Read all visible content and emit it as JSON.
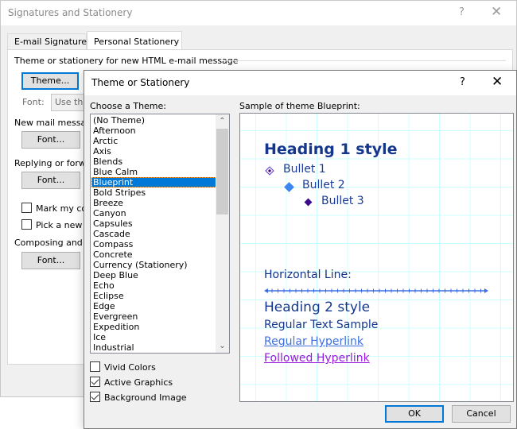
{
  "back_window": {
    "title": "Signatures and Stationery",
    "help_glyph": "?",
    "close_glyph": "✕",
    "tabs": [
      {
        "label": "E-mail Signature",
        "selected": false
      },
      {
        "label": "Personal Stationery",
        "selected": true
      }
    ],
    "theme_group_label": "Theme or stationery for new HTML e-mail message",
    "theme_button": "Theme...",
    "font_label": "Font:",
    "font_field_value": "Use theme's font",
    "new_mail_label": "New mail messages",
    "new_mail_font_button": "Font...",
    "replying_label": "Replying or forwarding messages",
    "replying_font_button": "Font...",
    "mark_comments_label": "Mark my comments with:",
    "mark_comments_checked": false,
    "pick_color_label": "Pick a new color when replying or forwarding",
    "pick_color_checked": false,
    "composing_label": "Composing and reading plain text messages",
    "composing_font_button": "Font..."
  },
  "dialog": {
    "title": "Theme or Stationery",
    "help_glyph": "?",
    "close_glyph": "✕",
    "choose_label": "Choose a Theme:",
    "sample_label": "Sample of theme Blueprint:",
    "themes": [
      "(No Theme)",
      "Afternoon",
      "Arctic",
      "Axis",
      "Blends",
      "Blue Calm",
      "Blueprint",
      "Bold Stripes",
      "Breeze",
      "Canyon",
      "Capsules",
      "Cascade",
      "Compass",
      "Concrete",
      "Currency (Stationery)",
      "Deep Blue",
      "Echo",
      "Eclipse",
      "Edge",
      "Evergreen",
      "Expedition",
      "Ice",
      "Industrial"
    ],
    "selected_theme": "Blueprint",
    "scroll_up_glyph": "⌃",
    "scroll_down_glyph": "⌄",
    "options": [
      {
        "label": "Vivid Colors",
        "checked": false
      },
      {
        "label": "Active Graphics",
        "checked": true
      },
      {
        "label": "Background Image",
        "checked": true
      }
    ],
    "preview": {
      "heading1": "Heading 1 style",
      "bullets": [
        "Bullet 1",
        "Bullet 2",
        "Bullet 3"
      ],
      "hr_label": "Horizontal Line:",
      "heading2": "Heading 2 style",
      "regular_text": "Regular Text Sample",
      "hyperlink": "Regular Hyperlink",
      "followed_hyperlink": "Followed Hyperlink",
      "colors": {
        "heading": "#14368c",
        "link": "#3d6fe0",
        "followed_link": "#9a1ae0",
        "grid": "#ccffff"
      }
    },
    "ok_button": "OK",
    "cancel_button": "Cancel"
  }
}
